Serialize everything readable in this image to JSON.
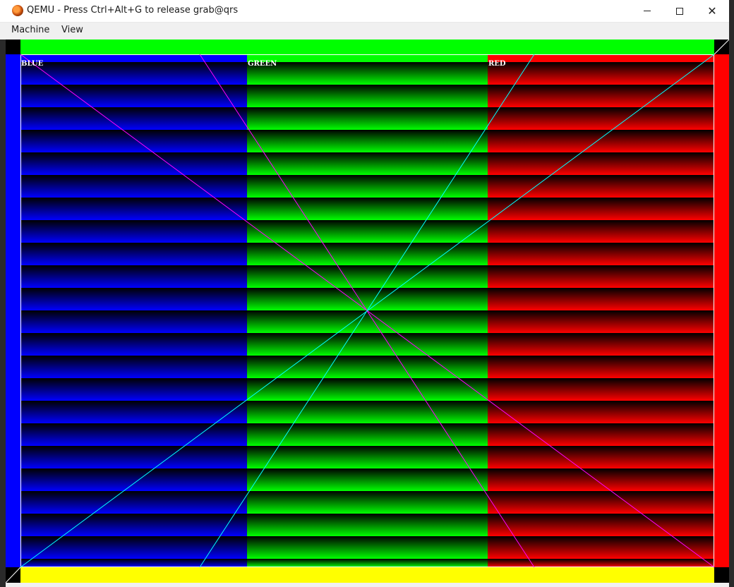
{
  "window": {
    "title": "QEMU - Press Ctrl+Alt+G to release grab@qrs"
  },
  "menu": {
    "items": [
      "Machine",
      "View"
    ]
  },
  "window_controls": {
    "minimize_icon": "minimize-icon",
    "maximize_icon": "maximize-icon",
    "close_icon": "close-icon"
  },
  "test_pattern": {
    "labels": [
      "BLUE",
      "GREEN",
      "RED"
    ],
    "colors": {
      "border_top": "#00ff00",
      "border_bottom": "#ffff00",
      "border_left": "#0000ff",
      "border_right": "#ff0000",
      "blue": "#0000ff",
      "green": "#00ff00",
      "red": "#ff0000",
      "diagonal_1": "#ff00ff",
      "diagonal_2": "#00ffff"
    }
  }
}
